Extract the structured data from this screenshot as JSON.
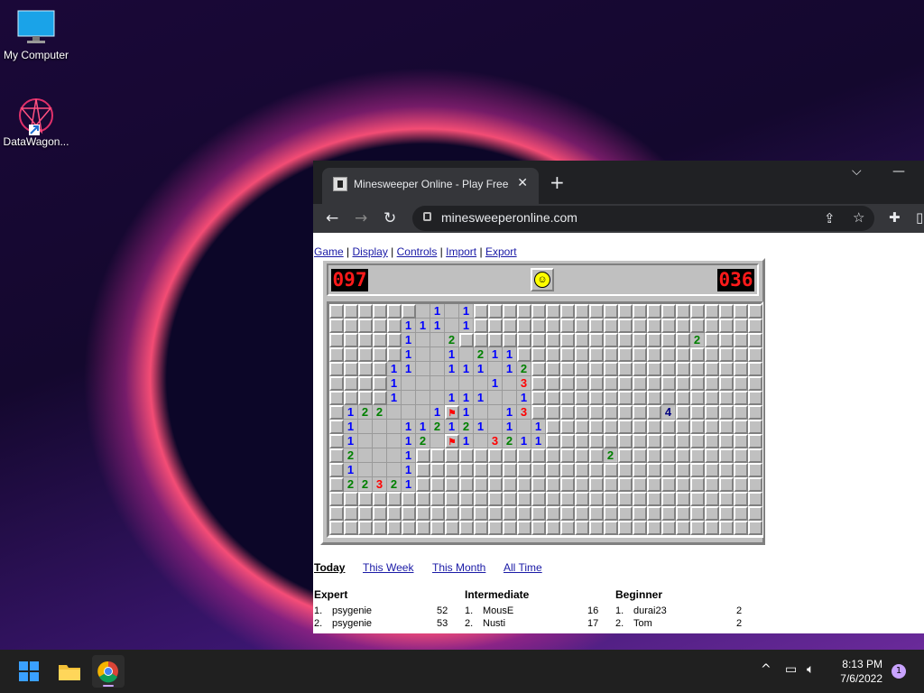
{
  "desktop": {
    "icons": [
      {
        "label": "My Computer"
      },
      {
        "label": "DataWagon..."
      }
    ]
  },
  "browser": {
    "tab_title": "Minesweeper Online - Play Free Online",
    "url": "minesweeperonline.com"
  },
  "page": {
    "menu": [
      "Game",
      "Display",
      "Controls",
      "Import",
      "Export"
    ],
    "mine_counter": "097",
    "timer": "036",
    "smiley": "☺",
    "board_rows": [
      "______c1c1______________________",
      "_____111c1______________________",
      "_____1cc2________________2______",
      "_____1cc1c211___________________",
      "____11cc111c12__________________",
      "____1cccccc1c3__________________",
      "____1ccc111cc1__________________",
      "_122ccc1F1cc13_________4________",
      "_1ccc112121c1c1_________________",
      "_1ccc12cF1c3211_________________",
      "_2ccc1_____________2____________",
      "_1ccc1__________________________",
      "_22321__________________________",
      "________________________________",
      "________________________________",
      "________________________________"
    ],
    "score_tabs": [
      "Today",
      "This Week",
      "This Month",
      "All Time"
    ],
    "active_tab": "Today",
    "score_sections": [
      {
        "title": "Expert",
        "rows": [
          {
            "rank": "1.",
            "name": "psygenie",
            "time": "52"
          },
          {
            "rank": "2.",
            "name": "psygenie",
            "time": "53"
          }
        ]
      },
      {
        "title": "Intermediate",
        "rows": [
          {
            "rank": "1.",
            "name": "MousE",
            "time": "16"
          },
          {
            "rank": "2.",
            "name": "Nusti",
            "time": "17"
          }
        ]
      },
      {
        "title": "Beginner",
        "rows": [
          {
            "rank": "1.",
            "name": "durai23",
            "time": "2"
          },
          {
            "rank": "2.",
            "name": "Tom",
            "time": "2"
          }
        ]
      }
    ]
  },
  "taskbar": {
    "time": "8:13 PM",
    "date": "7/6/2022",
    "notification_count": "1",
    "apps": [
      "start-icon",
      "file-explorer-icon",
      "chrome-icon"
    ]
  }
}
